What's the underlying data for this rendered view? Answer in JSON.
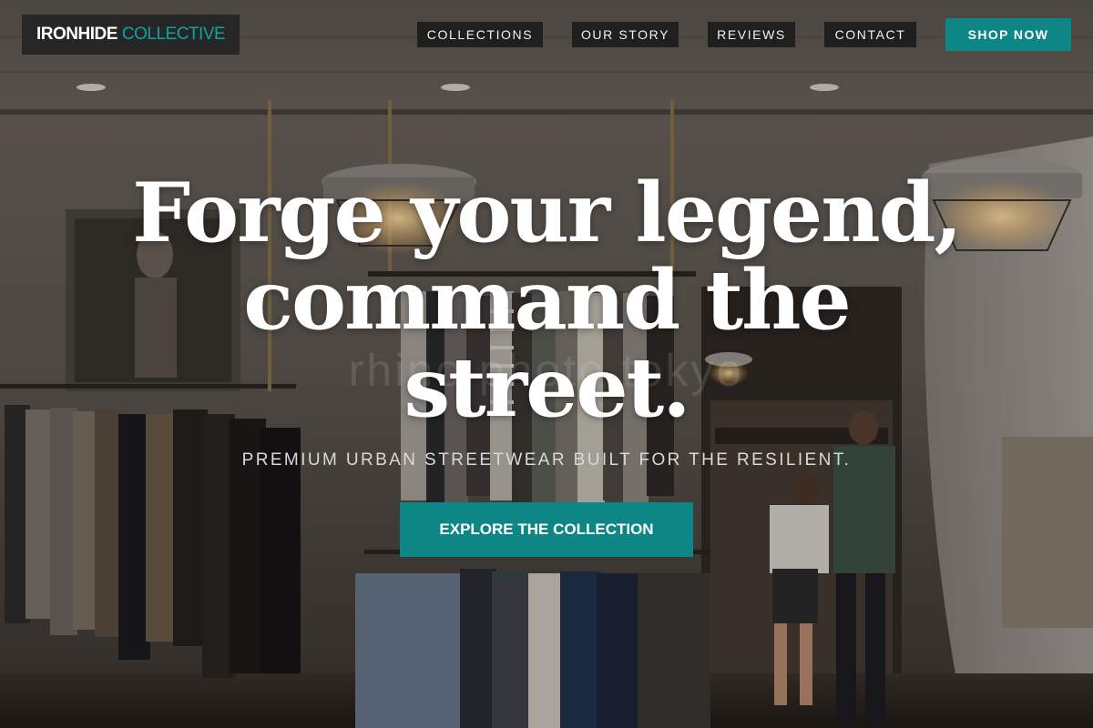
{
  "brand": {
    "part1": "IRONHIDE",
    "part2": "COLLECTIVE",
    "accent_color": "#0e8686"
  },
  "nav": {
    "items": [
      {
        "label": "COLLECTIONS"
      },
      {
        "label": "OUR STORY"
      },
      {
        "label": "REVIEWS"
      },
      {
        "label": "CONTACT"
      }
    ],
    "cta_label": "SHOP NOW"
  },
  "hero": {
    "headline_lines": [
      "Forge your legend,",
      "command the",
      "street."
    ],
    "watermark": "rhino photo tokyo",
    "subtitle": "PREMIUM URBAN STREETWEAR BUILT FOR THE RESILIENT.",
    "cta_label": "EXPLORE THE COLLECTION"
  }
}
